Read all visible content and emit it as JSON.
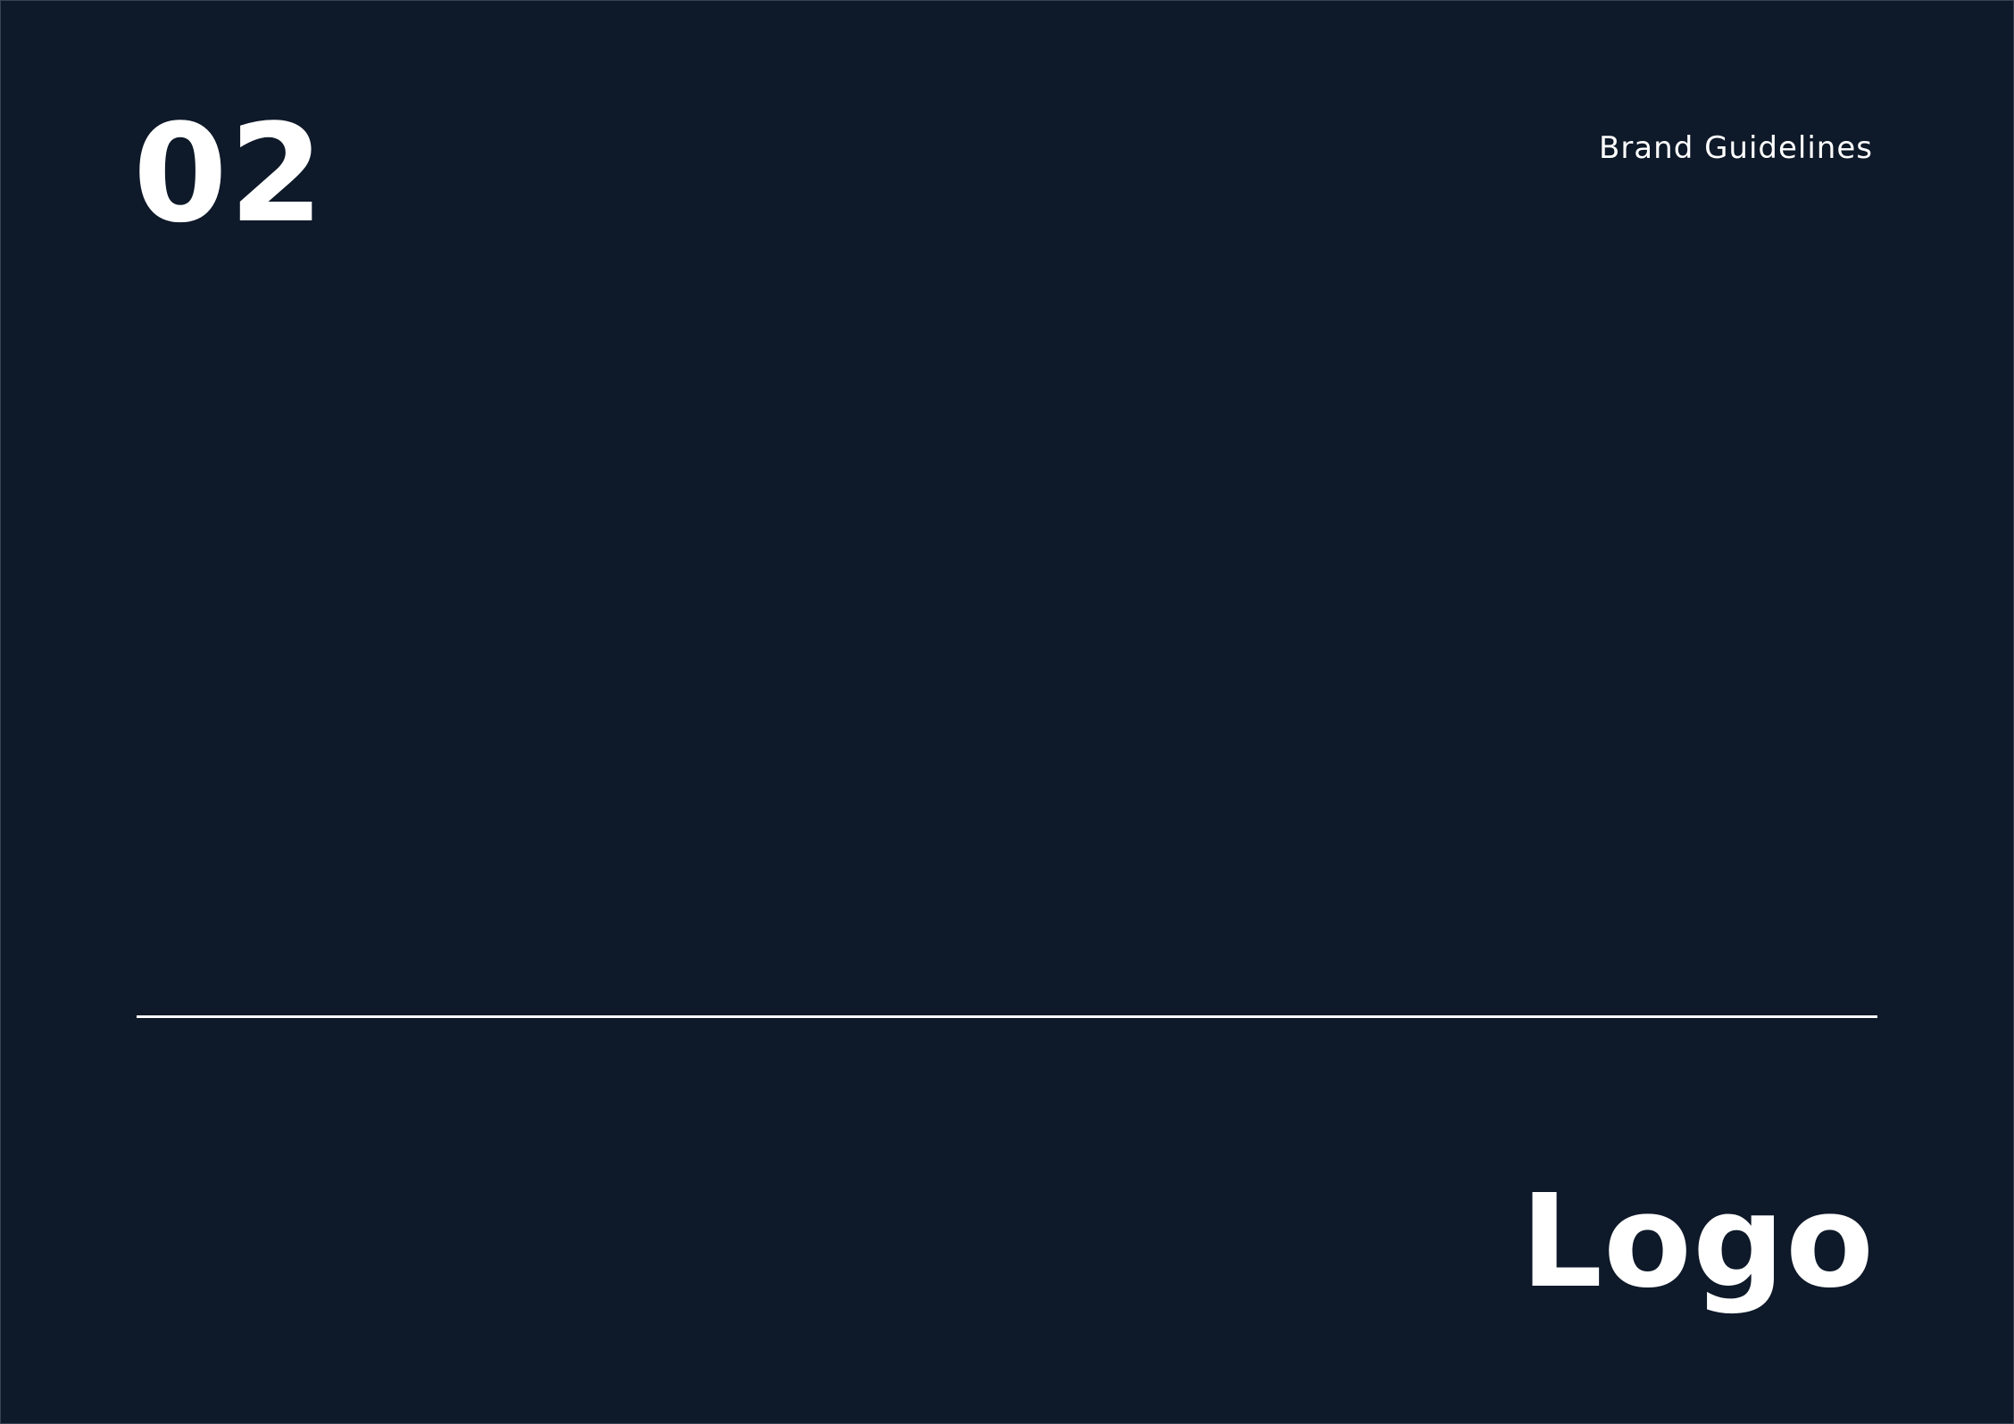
{
  "header": {
    "section_number": "02",
    "document_title": "Brand Guidelines"
  },
  "footer": {
    "section_title": "Logo"
  },
  "colors": {
    "background": "#0e1929",
    "text": "#ffffff",
    "divider": "#ffffff"
  }
}
